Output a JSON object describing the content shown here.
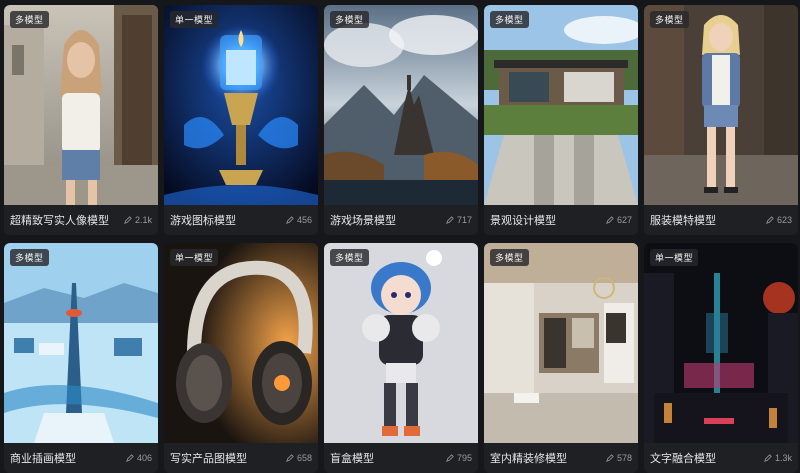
{
  "cards": [
    {
      "badge": "多模型",
      "title": "超精致写实人像模型",
      "count": "2.1k"
    },
    {
      "badge": "单一模型",
      "title": "游戏图标模型",
      "count": "456"
    },
    {
      "badge": "多模型",
      "title": "游戏场景模型",
      "count": "717"
    },
    {
      "badge": "多模型",
      "title": "景观设计模型",
      "count": "627"
    },
    {
      "badge": "多模型",
      "title": "服装模特模型",
      "count": "623"
    },
    {
      "badge": "多模型",
      "title": "商业插画模型",
      "count": "406"
    },
    {
      "badge": "单一模型",
      "title": "写实产品图模型",
      "count": "658"
    },
    {
      "badge": "多模型",
      "title": "盲盒模型",
      "count": "795"
    },
    {
      "badge": "多模型",
      "title": "室内精装修模型",
      "count": "578"
    },
    {
      "badge": "单一模型",
      "title": "文字融合模型",
      "count": "1.3k"
    }
  ],
  "icons": {
    "count_icon": "pencil-icon"
  }
}
